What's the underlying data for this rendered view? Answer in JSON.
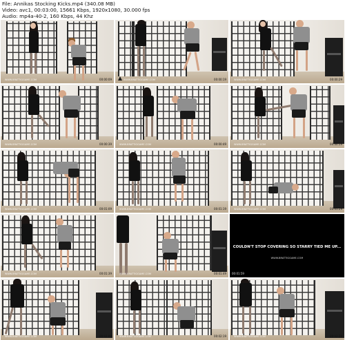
{
  "header": {
    "file": "File: Annikas Stocking Kicks.mp4 (340.08 MB)",
    "video": "Video: avc1, 00:03:00, 15661 Kbps, 1920x1080, 30.000 fps",
    "audio": "Audio: mp4a-40-2, 160 Kbps, 44 Khz"
  },
  "watermark_text": "WWW.BRATTIGGAME.COM",
  "caption": {
    "text": "COULDN'T STOP COVERING SO STARRY TIED ME UP..."
  },
  "thumbnails": [
    {
      "index": 1,
      "timestamp": "00:00:09"
    },
    {
      "index": 2,
      "timestamp": "00:00:19"
    },
    {
      "index": 3,
      "timestamp": "00:00:29"
    },
    {
      "index": 4,
      "timestamp": "00:00:39"
    },
    {
      "index": 5,
      "timestamp": "00:00:49"
    },
    {
      "index": 6,
      "timestamp": "00:00:59"
    },
    {
      "index": 7,
      "timestamp": "00:01:09"
    },
    {
      "index": 8,
      "timestamp": "00:01:19"
    },
    {
      "index": 9,
      "timestamp": "00:01:29"
    },
    {
      "index": 10,
      "timestamp": "00:01:39"
    },
    {
      "index": 11,
      "timestamp": "00:01:49"
    },
    {
      "index": 12,
      "timestamp": "00:01:59"
    },
    {
      "index": 13,
      "timestamp": "00:02:09"
    },
    {
      "index": 14,
      "timestamp": "00:02:19"
    },
    {
      "index": 15,
      "timestamp": "00:02:29"
    }
  ],
  "colors": {
    "background": "#ffffff",
    "caption_bg": "#000000",
    "caption_text": "#ffffff"
  }
}
